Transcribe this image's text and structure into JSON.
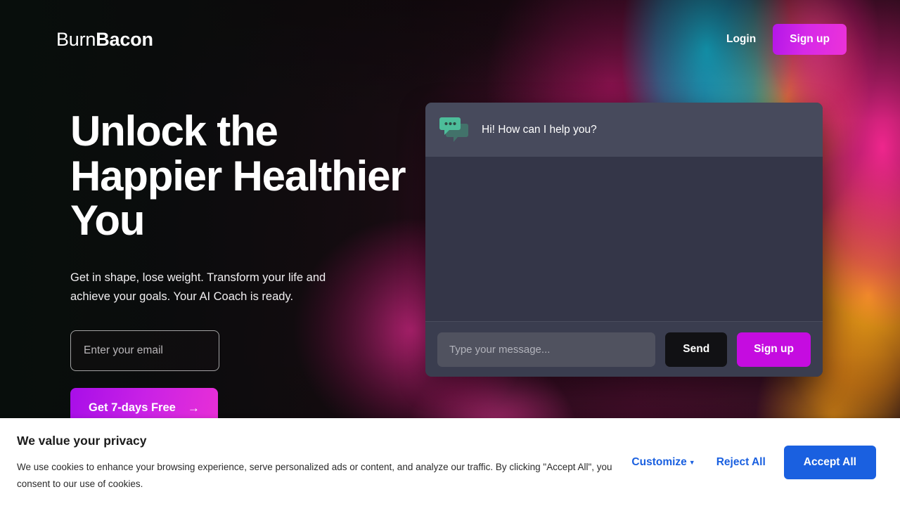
{
  "nav": {
    "logo_thin": "Burn",
    "logo_bold": "Bacon",
    "login_label": "Login",
    "signup_label": "Sign up"
  },
  "hero": {
    "headline": "Unlock the Happier Healthier You",
    "subtitle": "Get in shape, lose weight. Transform your life and achieve your goals. Your AI Coach is ready.",
    "email_placeholder": "Enter your email",
    "email_value": "",
    "cta_label": "Get 7-days Free",
    "cta_arrow": "→"
  },
  "chat": {
    "greeting": "Hi! How can I help you?",
    "input_placeholder": "Type your message...",
    "input_value": "",
    "send_label": "Send",
    "signup_label": "Sign up",
    "icon_name": "chat-bubble-icon"
  },
  "cookie": {
    "title": "We value your privacy",
    "body": "We use cookies to enhance your browsing experience, serve personalized ads or content, and analyze our traffic. By clicking \"Accept All\", you consent to our use of cookies.",
    "customize_label": "Customize",
    "customize_caret": "▼",
    "reject_label": "Reject All",
    "accept_label": "Accept All"
  },
  "colors": {
    "brand_magenta": "#c50ce0",
    "brand_gradient_start": "#a80ee8",
    "brand_gradient_end": "#e82fd6",
    "chat_header_bg": "#474a5c",
    "chat_body_bg": "#343648",
    "chat_icon_green": "#4dbd9a",
    "cookie_blue": "#1a60e0"
  }
}
